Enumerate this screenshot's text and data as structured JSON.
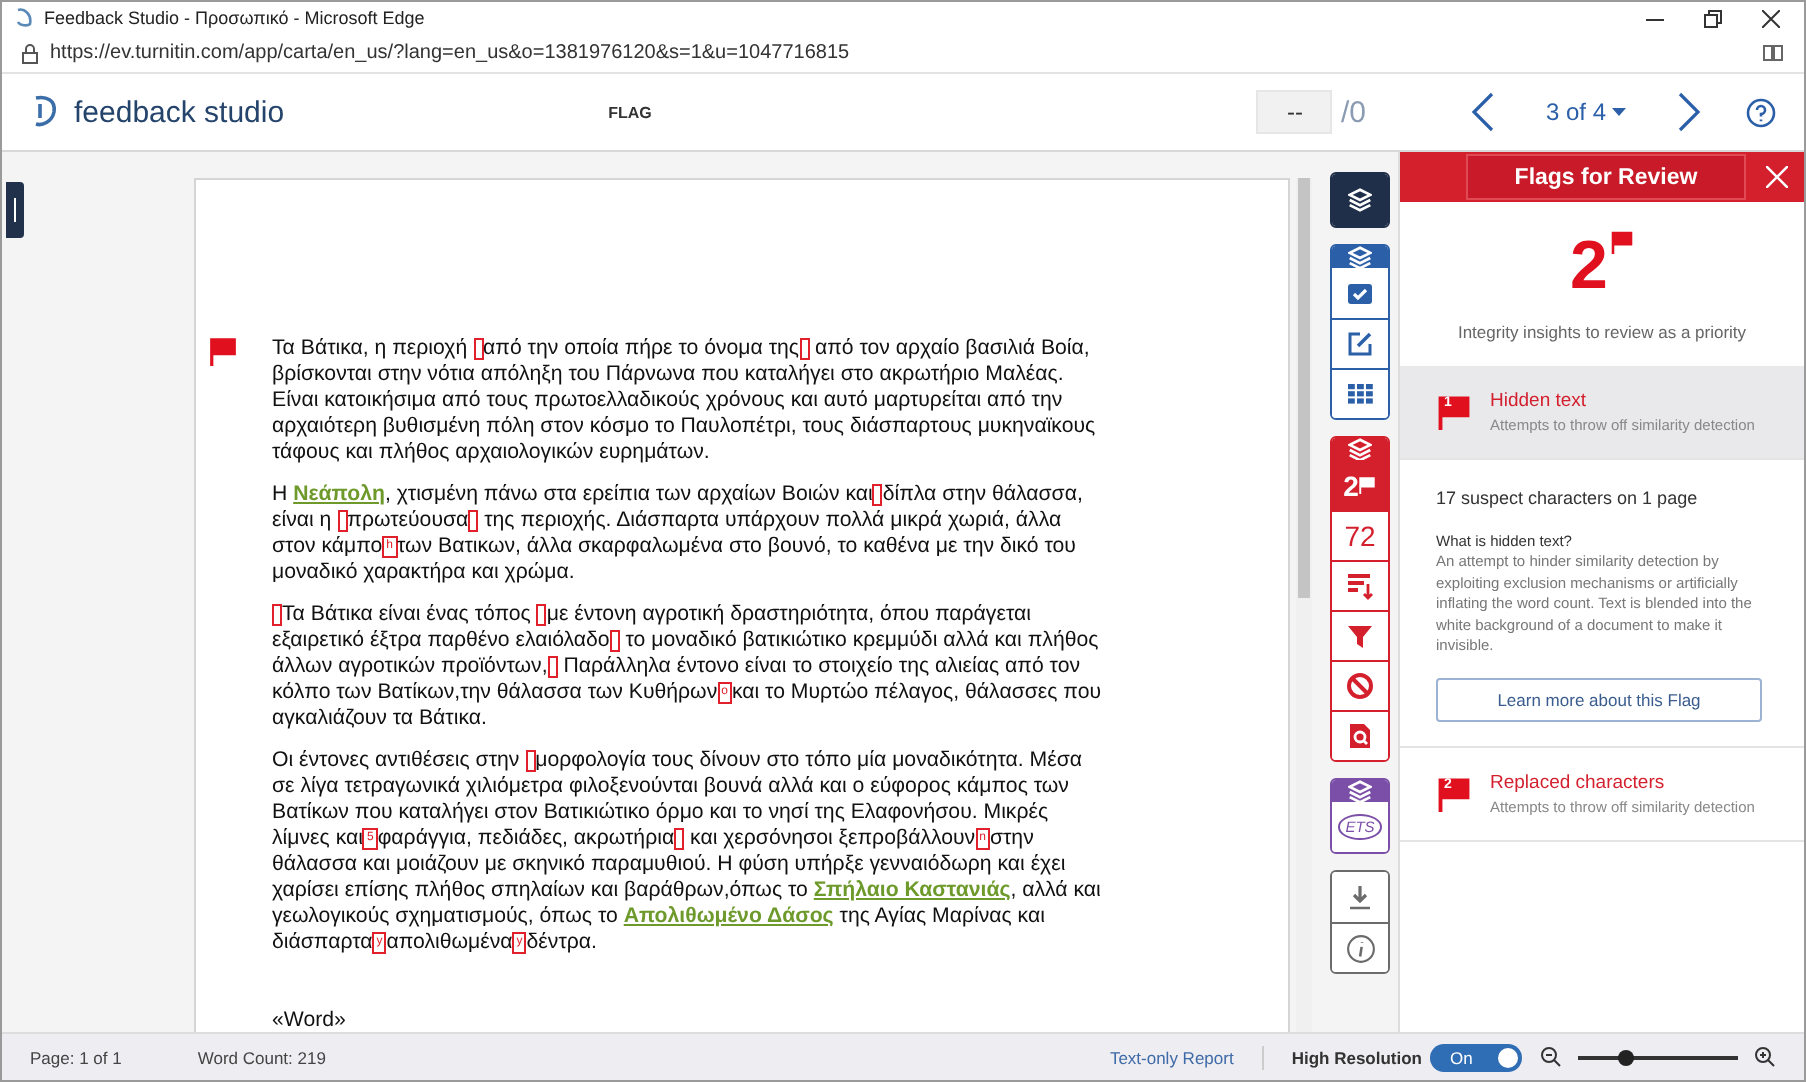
{
  "window": {
    "title": "Feedback Studio - Προσωπικό - Microsoft Edge",
    "url": "https://ev.turnitin.com/app/carta/en_us/?lang=en_us&o=1381976120&s=1&u=1047716815"
  },
  "header": {
    "logo_text": "feedback studio",
    "section": "FLAG",
    "page_input": "--",
    "page_total": "/0",
    "paper_position": "3 of 4"
  },
  "document": {
    "paragraphs": [
      {
        "segments": [
          {
            "kind": "text",
            "text": "Τα Βάτικα, η περιοχή "
          },
          {
            "kind": "mark"
          },
          {
            "kind": "text",
            "text": "από την οποία πήρε το όνομα της"
          },
          {
            "kind": "mark"
          },
          {
            "kind": "text",
            "text": " από τον αρχαίο βασιλιά Βοία, βρίσκονται στην νότια απόληξη του Πάρνωνα που καταλήγει στο ακρωτήριο Μαλέας. Είναι κατοικήσιμα από τους πρωτοελλαδικούς χρόνους και αυτό μαρτυρείται από την αρχαιότερη βυθισμένη πόλη στον κόσμο το Παυλοπέτρι, τους διάσπαρτους μυκηναϊκους τάφους και πλήθος αρχαιολογικών ευρημάτων."
          }
        ]
      },
      {
        "segments": [
          {
            "kind": "text",
            "text": "Η "
          },
          {
            "kind": "link",
            "text": "Νεάπολη"
          },
          {
            "kind": "text",
            "text": ", χτισμένη πάνω στα ερείπια των αρχαίων Βοιών και"
          },
          {
            "kind": "mark"
          },
          {
            "kind": "text",
            "text": "δίπλα στην θάλασσα, είναι η "
          },
          {
            "kind": "mark"
          },
          {
            "kind": "text",
            "text": "πρωτεύουσα"
          },
          {
            "kind": "mark"
          },
          {
            "kind": "text",
            "text": " της περιοχής. Διάσπαρτα υπάρχουν πολλά μικρά χωριά, άλλα στον κάμπο"
          },
          {
            "kind": "mark",
            "text": "h"
          },
          {
            "kind": "text",
            "text": "των Βατικων, άλλα σκαρφαλωμένα στο βουνό, το καθένα με την δικό του μοναδικό χαρακτήρα και χρώμα."
          }
        ]
      },
      {
        "segments": [
          {
            "kind": "mark"
          },
          {
            "kind": "text",
            "text": "Τα Βάτικα είναι ένας τόπος "
          },
          {
            "kind": "mark"
          },
          {
            "kind": "text",
            "text": "με έντονη αγροτική δραστηριότητα, όπου παράγεται εξαιρετικό έξτρα παρθένο ελαιόλαδο"
          },
          {
            "kind": "mark"
          },
          {
            "kind": "text",
            "text": " το μοναδικό βατικιώτικο κρεμμύδι αλλά και πλήθος άλλων αγροτικών προϊόντων,"
          },
          {
            "kind": "mark"
          },
          {
            "kind": "text",
            "text": " Παράλληλα έντονο είναι το στοιχείο της αλιείας από τον κόλπο των Βατίκων,την θάλασσα των Κυθήρων"
          },
          {
            "kind": "mark",
            "text": "o"
          },
          {
            "kind": "text",
            "text": "και το Μυρτώο πέλαγος, θάλασσες που αγκαλιάζουν τα Βάτικα."
          }
        ]
      },
      {
        "segments": [
          {
            "kind": "text",
            "text": "Οι έντονες αντιθέσεις στην "
          },
          {
            "kind": "mark"
          },
          {
            "kind": "text",
            "text": "μορφολογία τους δίνουν στο τόπο μία μοναδικότητα. Μέσα σε λίγα τετραγωνικά χιλιόμετρα φιλοξενούνται βουνά αλλά και ο εύφορος κάμπος των Βατίκων που καταλήγει στον Βατικιώτικο όρμο και το νησί της Ελαφονήσου. Μικρές λίμνες και"
          },
          {
            "kind": "mark",
            "text": "5"
          },
          {
            "kind": "text",
            "text": "φαράγγια, πεδιάδες, ακρωτήρια"
          },
          {
            "kind": "mark"
          },
          {
            "kind": "text",
            "text": " και χερσόνησοι ξεπροβάλλουν"
          },
          {
            "kind": "mark",
            "text": "n"
          },
          {
            "kind": "text",
            "text": "στην θάλασσα και μοιάζουν με σκηνικό παραμυθιού. Η φύση υπήρξε γενναιόδωρη και έχει χαρίσει επίσης πλήθος σπηλαίων και βαράθρων,όπως το "
          },
          {
            "kind": "link",
            "text": "Σπήλαιο Καστανιάς"
          },
          {
            "kind": "text",
            "text": ", αλλά και γεωλογικούς σχηματισμούς, όπως το "
          },
          {
            "kind": "link",
            "text": "Απολιθωμένο Δάσος"
          },
          {
            "kind": "text",
            "text": " της Αγίας Μαρίνας και διάσπαρτα"
          },
          {
            "kind": "mark",
            "text": "y"
          },
          {
            "kind": "text",
            "text": "απολιθωμένα"
          },
          {
            "kind": "mark",
            "text": "y"
          },
          {
            "kind": "text",
            "text": "δέντρα."
          }
        ]
      },
      {
        "segments": [
          {
            "kind": "text",
            "text": "«Word»"
          }
        ]
      }
    ]
  },
  "toolbar": {
    "groups": [
      {
        "kind": "view",
        "items": [
          {
            "kind": "layers",
            "selected": true
          }
        ]
      },
      {
        "kind": "grading",
        "items": [
          {
            "kind": "rubric",
            "selected": false
          },
          {
            "kind": "edit",
            "selected": false
          },
          {
            "kind": "grid",
            "selected": false
          }
        ]
      },
      {
        "kind": "similarity",
        "items": [
          {
            "kind": "flag-count",
            "text": "2",
            "selected": true
          },
          {
            "kind": "count",
            "text": "72",
            "selected": false
          },
          {
            "kind": "sort",
            "selected": false
          },
          {
            "kind": "filter",
            "selected": false
          },
          {
            "kind": "ban",
            "selected": false
          },
          {
            "kind": "doc-search",
            "selected": false
          }
        ]
      },
      {
        "kind": "ets",
        "items": [
          {
            "kind": "ets",
            "text": "ETS",
            "selected": false
          }
        ]
      },
      {
        "kind": "utility",
        "items": [
          {
            "kind": "download",
            "selected": false
          },
          {
            "kind": "info",
            "selected": false
          }
        ]
      }
    ]
  },
  "panel": {
    "title": "Flags for Review",
    "count": "2",
    "subtitle": "Integrity insights to review as a priority",
    "flags": [
      {
        "number": "1",
        "title": "Hidden text",
        "description": "Attempts to throw off similarity detection",
        "selected": true,
        "expanded": true,
        "details": {
          "summary": "17 suspect characters on 1 page",
          "question": "What is hidden text?",
          "explanation": "An attempt to hinder similarity detection by exploiting exclusion mechanisms or artificially inflating the word count. Text is blended into the white background of a document to make it invisible.",
          "button": "Learn more about this Flag"
        }
      },
      {
        "number": "2",
        "title": "Replaced characters",
        "description": "Attempts to throw off similarity detection",
        "selected": false,
        "expanded": false
      }
    ]
  },
  "status_bar": {
    "page": "Page: 1 of 1",
    "word_count": "Word Count: 219",
    "report_link": "Text-only Report",
    "high_resolution": {
      "label": "High Resolution",
      "toggle_text": "On",
      "on": true
    },
    "zoom": {
      "level": 0.3
    }
  }
}
